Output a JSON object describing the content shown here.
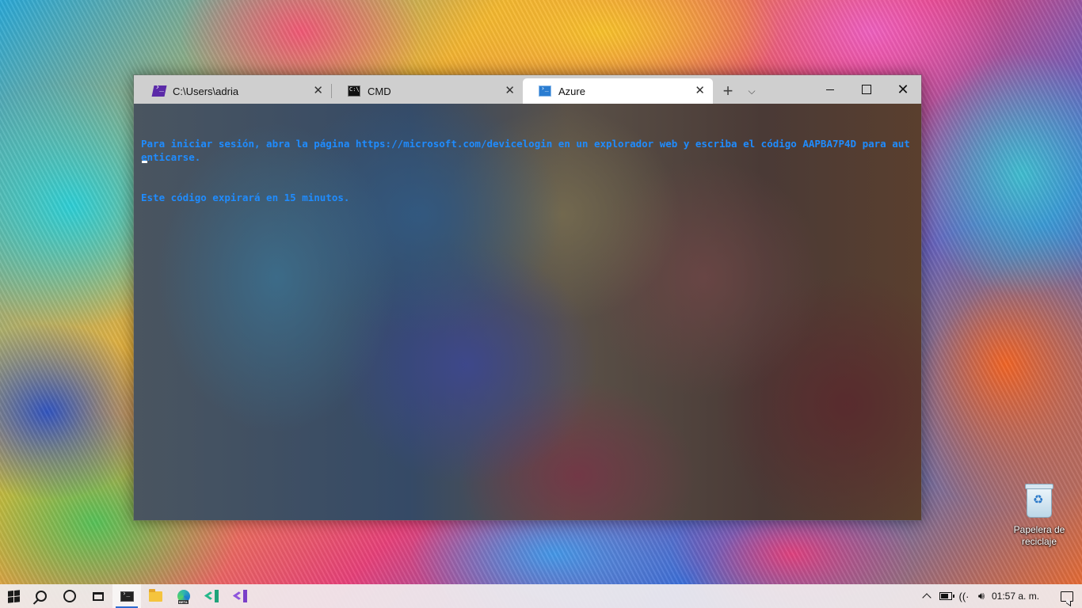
{
  "window": {
    "tabs": [
      {
        "label": "C:\\Users\\adria",
        "icon": "powershell-icon",
        "active": false
      },
      {
        "label": "CMD",
        "icon": "cmd-icon",
        "active": false
      },
      {
        "label": "Azure",
        "icon": "azure-cloud-shell-icon",
        "active": true
      }
    ],
    "close_glyph": "✕",
    "new_tab_glyph": "+",
    "dropdown_glyph": "⌵",
    "controls": {
      "minimize": "minimize",
      "maximize": "maximize",
      "close": "✕"
    }
  },
  "terminal": {
    "text_color": "#1f8cff",
    "lines": [
      "Para iniciar sesión, abra la página https://microsoft.com/devicelogin en un explorador web y escriba el código AAPBA7P4D para autenticarse.",
      "Este código expirará en 15 minutos."
    ]
  },
  "desktop": {
    "icons": [
      {
        "label": "Papelera de reciclaje",
        "icon": "recycle-bin-icon"
      }
    ]
  },
  "taskbar": {
    "start_icon": "windows-logo-icon",
    "search_icon": "search-icon",
    "cortana_icon": "cortana-icon",
    "task_view_icon": "task-view-icon",
    "apps": [
      {
        "name": "Windows Terminal",
        "icon": "terminal-app-icon",
        "active": true
      },
      {
        "name": "File Explorer",
        "icon": "file-explorer-icon",
        "active": false
      },
      {
        "name": "Microsoft Edge Beta",
        "icon": "edge-beta-icon",
        "active": false
      },
      {
        "name": "Visual Studio Code",
        "icon": "vscode-icon",
        "active": false
      },
      {
        "name": "Visual Studio",
        "icon": "visual-studio-icon",
        "active": false
      }
    ],
    "accent_color": "#2d6bd1",
    "tray": {
      "clock": "01:57 a. m.",
      "wifi_glyph": "((·",
      "volume_glyph": "🔊︎"
    }
  }
}
